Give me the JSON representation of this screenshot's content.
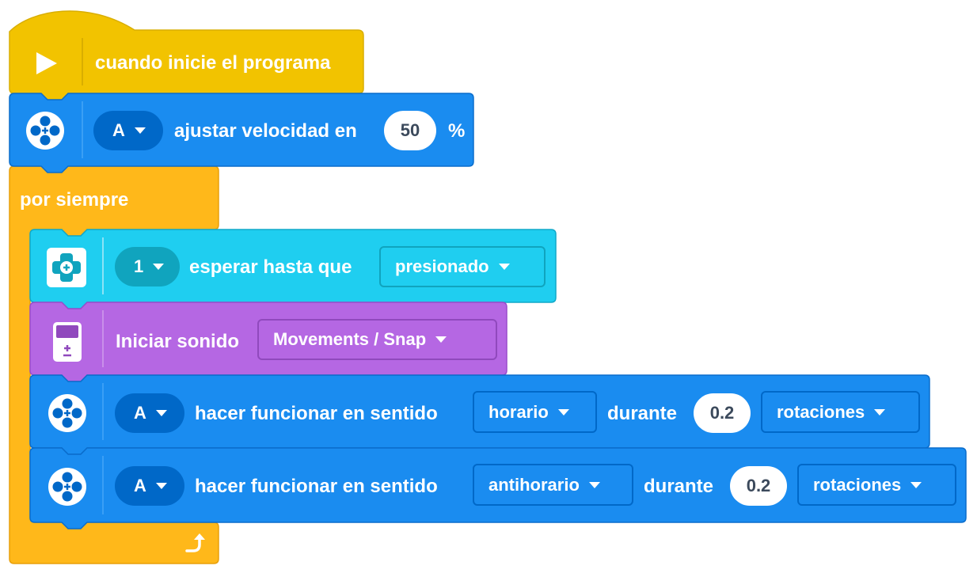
{
  "colors": {
    "event": "#F2C300",
    "motor": "#1A8CF0",
    "motor_dark": "#0068C8",
    "control": "#FFB81A",
    "sensor": "#1FCEF0",
    "sensor_dark": "#10A4BE",
    "sound": "#B567E3",
    "sound_dark": "#9049BD"
  },
  "hat_block": {
    "label": "cuando inicie el programa",
    "icon": "play-icon"
  },
  "speed_block": {
    "port": "A",
    "label": "ajustar velocidad en",
    "value": "50",
    "unit": "%",
    "icon": "motor-icon"
  },
  "forever_block": {
    "label": "por siempre",
    "loop_icon": "loop-arrow-icon"
  },
  "wait_block": {
    "port": "1",
    "label": "esperar hasta que",
    "state": "presionado",
    "icon": "force-sensor-icon"
  },
  "sound_block": {
    "label": "Iniciar sonido",
    "sound": "Movements / Snap",
    "icon": "hub-icon"
  },
  "run_block_1": {
    "port": "A",
    "label": "hacer funcionar  en sentido",
    "direction": "horario",
    "during": "durante",
    "value": "0.2",
    "unit": "rotaciones",
    "icon": "motor-icon"
  },
  "run_block_2": {
    "port": "A",
    "label": "hacer funcionar  en sentido",
    "direction": "antihorario",
    "during": "durante",
    "value": "0.2",
    "unit": "rotaciones",
    "icon": "motor-icon"
  }
}
